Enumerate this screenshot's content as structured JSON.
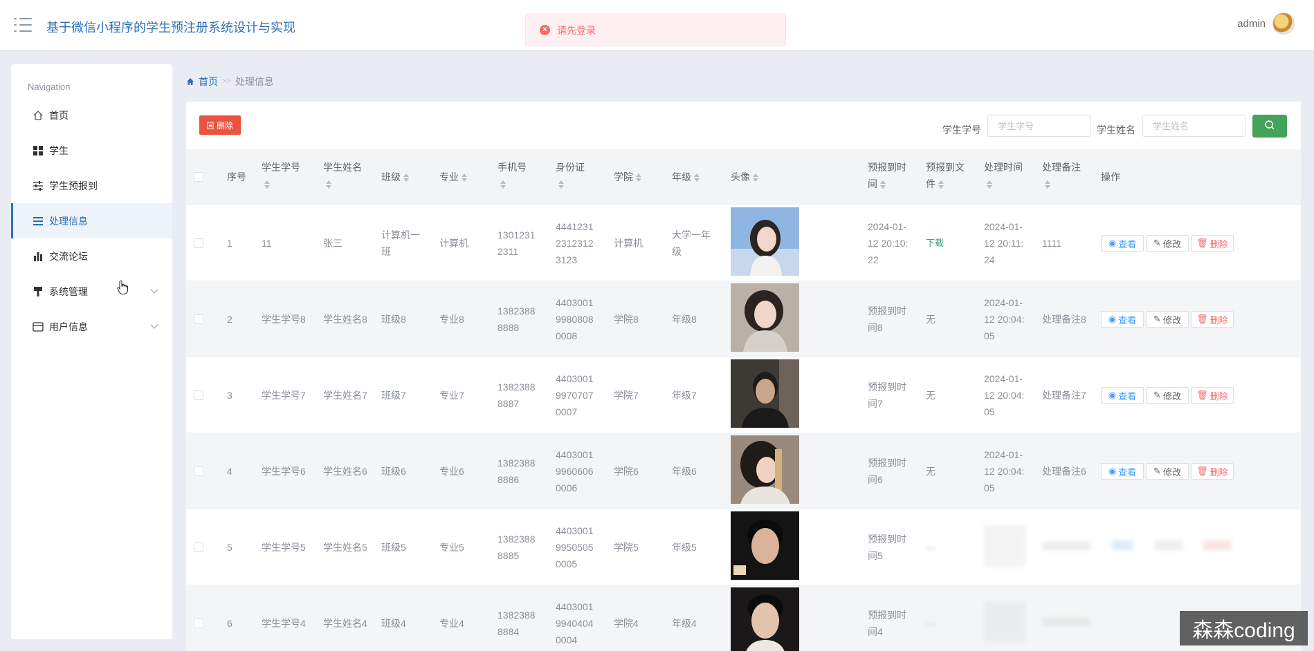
{
  "header": {
    "title": "基于微信小程序的学生预注册系统设计与实现",
    "user_name": "admin"
  },
  "toast": {
    "message": "请先登录",
    "type_color": "#f56c6c"
  },
  "sidebar": {
    "heading": "Navigation",
    "items": [
      {
        "label": "首页",
        "icon": "home-icon"
      },
      {
        "label": "学生",
        "icon": "grid-icon"
      },
      {
        "label": "学生预报到",
        "icon": "sliders-icon"
      },
      {
        "label": "处理信息",
        "icon": "list-icon",
        "active": true
      },
      {
        "label": "交流论坛",
        "icon": "bar-chart-icon"
      },
      {
        "label": "系统管理",
        "icon": "brush-icon",
        "has_submenu": true
      },
      {
        "label": "用户信息",
        "icon": "card-icon",
        "has_submenu": true
      }
    ]
  },
  "breadcrumb": {
    "home": "首页",
    "separator": ">>",
    "current": "处理信息"
  },
  "toolbar": {
    "delete_label": "删除",
    "student_no_label": "学生学号",
    "student_no_placeholder": "学生学号",
    "student_name_label": "学生姓名",
    "student_name_placeholder": "学生姓名"
  },
  "table": {
    "headers": {
      "index": "序号",
      "student_no": "学生学号",
      "student_name": "学生姓名",
      "class": "班级",
      "major": "专业",
      "phone": "手机号",
      "id_card": "身份证",
      "college": "学院",
      "grade": "年级",
      "photo": "头像",
      "report_time_1": "预报到时",
      "report_time_2": "间",
      "report_file_1": "预报到文",
      "report_file_2": "件",
      "process_time": "处理时间",
      "process_note": "处理备注",
      "actions": "操作"
    },
    "actions": {
      "view": "查看",
      "edit": "修改",
      "delete": "删除"
    },
    "rows": [
      {
        "index": "1",
        "student_no": "11",
        "student_name": "张三",
        "class_1": "计算机一",
        "class_2": "班",
        "major": "计算机",
        "phone_1": "1301231",
        "phone_2": "2311",
        "id_1": "4441231",
        "id_2": "2312312",
        "id_3": "3123",
        "college": "计算机",
        "grade_1": "大学一年",
        "grade_2": "级",
        "report_1": "2024-01-",
        "report_2": "12 20:10:",
        "report_3": "22",
        "file": "下载",
        "ptime_1": "2024-01-",
        "ptime_2": "12 20:11:",
        "ptime_3": "24",
        "note": "1111"
      },
      {
        "index": "2",
        "student_no": "学生学号8",
        "student_name": "学生姓名8",
        "class_1": "班级8",
        "class_2": "",
        "major": "专业8",
        "phone_1": "1382388",
        "phone_2": "8888",
        "id_1": "4403001",
        "id_2": "9980808",
        "id_3": "0008",
        "college": "学院8",
        "grade_1": "年级8",
        "grade_2": "",
        "report_1": "预报到时",
        "report_2": "间8",
        "report_3": "",
        "file": "无",
        "ptime_1": "2024-01-",
        "ptime_2": "12 20:04:",
        "ptime_3": "05",
        "note": "处理备注8"
      },
      {
        "index": "3",
        "student_no": "学生学号7",
        "student_name": "学生姓名7",
        "class_1": "班级7",
        "class_2": "",
        "major": "专业7",
        "phone_1": "1382388",
        "phone_2": "8887",
        "id_1": "4403001",
        "id_2": "9970707",
        "id_3": "0007",
        "college": "学院7",
        "grade_1": "年级7",
        "grade_2": "",
        "report_1": "预报到时",
        "report_2": "间7",
        "report_3": "",
        "file": "无",
        "ptime_1": "2024-01-",
        "ptime_2": "12 20:04:",
        "ptime_3": "05",
        "note": "处理备注7"
      },
      {
        "index": "4",
        "student_no": "学生学号6",
        "student_name": "学生姓名6",
        "class_1": "班级6",
        "class_2": "",
        "major": "专业6",
        "phone_1": "1382388",
        "phone_2": "8886",
        "id_1": "4403001",
        "id_2": "9960606",
        "id_3": "0006",
        "college": "学院6",
        "grade_1": "年级6",
        "grade_2": "",
        "report_1": "预报到时",
        "report_2": "间6",
        "report_3": "",
        "file": "无",
        "ptime_1": "2024-01-",
        "ptime_2": "12 20:04:",
        "ptime_3": "05",
        "note": "处理备注6"
      },
      {
        "index": "5",
        "student_no": "学生学号5",
        "student_name": "学生姓名5",
        "class_1": "班级5",
        "class_2": "",
        "major": "专业5",
        "phone_1": "1382388",
        "phone_2": "8885",
        "id_1": "4403001",
        "id_2": "9950505",
        "id_3": "0005",
        "college": "学院5",
        "grade_1": "年级5",
        "grade_2": "",
        "report_1": "预报到时",
        "report_2": "间5",
        "report_3": ""
      },
      {
        "index": "6",
        "student_no": "学生学号4",
        "student_name": "学生姓名4",
        "class_1": "班级4",
        "class_2": "",
        "major": "专业4",
        "phone_1": "1382388",
        "phone_2": "8884",
        "id_1": "4403001",
        "id_2": "9940404",
        "id_3": "0004",
        "college": "学院4",
        "grade_1": "年级4",
        "grade_2": "",
        "report_1": "预报到时",
        "report_2": "间4",
        "report_3": ""
      }
    ]
  },
  "watermark": "森森coding",
  "colors": {
    "primary": "#2d6fb7",
    "danger": "#e9533f",
    "search": "#45a25a",
    "link": "#409eff"
  }
}
